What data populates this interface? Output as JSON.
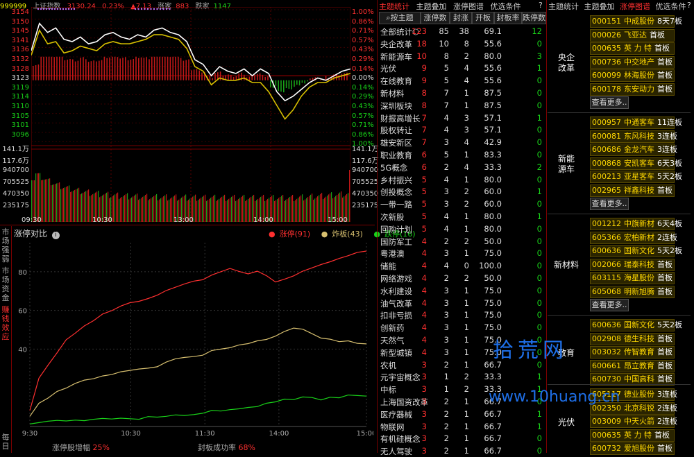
{
  "index_header": {
    "code": "999999",
    "name": "上证指数",
    "price": "3130.24",
    "pct": "0.23%",
    "change": "▲7.13",
    "up_label": "涨家",
    "up_count": "883",
    "down_label": "跌家",
    "down_count": "1147"
  },
  "left_axis": [
    "3154",
    "3150",
    "3145",
    "3141",
    "3136",
    "3132",
    "3128",
    "3123",
    "3119",
    "3114",
    "3110",
    "3105",
    "3101",
    "3096",
    "141.1万",
    "117.6万",
    "940700",
    "705525",
    "470350",
    "235175"
  ],
  "right_axis": [
    "1.00%",
    "0.86%",
    "0.71%",
    "0.57%",
    "0.43%",
    "0.29%",
    "0.14%",
    "0.00%",
    "0.14%",
    "0.29%",
    "0.43%",
    "0.57%",
    "0.71%",
    "0.86%",
    "1.00%",
    "141.1万",
    "117.6万",
    "940700",
    "705525",
    "470350",
    "235175"
  ],
  "time_axis": [
    "09:30",
    "10:30",
    "13:00",
    "14:00",
    "15:00"
  ],
  "zt_panel": {
    "title": "涨停对比",
    "legend": [
      {
        "label": "涨停(91)",
        "color": "#ff3030"
      },
      {
        "label": "炸板(43)",
        "color": "#d8c070"
      },
      {
        "label": "跌停(16)",
        "color": "#19d219"
      }
    ],
    "side_tabs": [
      "市场强弱",
      "市场资金",
      "赚钱效应",
      "每日"
    ],
    "footer_zf_label": "涨停股增幅",
    "footer_zf_value": "25%",
    "footer_fb_label": "封板成功率",
    "footer_fb_value": "68%"
  },
  "chart_data": [
    {
      "type": "line",
      "title": "",
      "xlabel": "",
      "ylabel": "",
      "x_ticks": [
        "09:30",
        "10:30",
        "13:00",
        "14:00",
        "15:00"
      ],
      "ylim": [
        3096,
        3154
      ],
      "series": [
        {
          "name": "",
          "color": "#ffffff",
          "values": [
            3136,
            3148,
            3144,
            3146,
            3141,
            3140,
            3142,
            3139,
            3140,
            3143,
            3144,
            3142,
            3141,
            3143,
            3142,
            3145,
            3146,
            3144,
            3143,
            3140,
            3132,
            3130,
            3125,
            3129,
            3127,
            3126,
            3128,
            3125,
            3128,
            3126,
            3118,
            3114,
            3116,
            3119,
            3122,
            3124,
            3123,
            3125,
            3127,
            3128
          ]
        },
        {
          "name": "",
          "color": "#d8c000",
          "values": [
            3134,
            3145,
            3139,
            3140,
            3135,
            3136,
            3138,
            3137,
            3136,
            3139,
            3140,
            3139,
            3139,
            3140,
            3141,
            3143,
            3143,
            3142,
            3141,
            3137,
            3129,
            3127,
            3121,
            3124,
            3123,
            3123,
            3124,
            3122,
            3122,
            3118,
            3112,
            3106,
            3110,
            3116,
            3120,
            3122,
            3122,
            3124,
            3125,
            3126
          ]
        }
      ]
    },
    {
      "type": "line",
      "title": "",
      "xlabel": "",
      "ylabel": "",
      "x_ticks": [
        "9:30",
        "10:30",
        "11:30",
        "14:00",
        "15:00"
      ],
      "yticks": [
        40,
        60,
        80
      ],
      "ylim": [
        0,
        95
      ],
      "series": [
        {
          "name": "涨停",
          "color": "#ff3030",
          "values": [
            8,
            25,
            32,
            38,
            45,
            48,
            52,
            55,
            58,
            60,
            62,
            64,
            65,
            66,
            68,
            70,
            72,
            74,
            75,
            76,
            78,
            80,
            82,
            80,
            79,
            80,
            78,
            75,
            76,
            78,
            80,
            82,
            84,
            85,
            87,
            88,
            90,
            91
          ]
        },
        {
          "name": "炸板",
          "color": "#d8c070",
          "values": [
            5,
            12,
            15,
            18,
            20,
            22,
            24,
            25,
            26,
            27,
            28,
            29,
            30,
            30,
            31,
            33,
            35,
            36,
            36,
            37,
            39,
            40,
            41,
            42,
            43,
            44,
            45,
            47,
            49,
            51,
            50,
            48,
            46,
            45,
            44,
            44,
            43,
            43
          ]
        },
        {
          "name": "跌停",
          "color": "#19d219",
          "values": [
            1,
            2,
            3,
            3,
            3,
            3,
            3,
            4,
            4,
            4,
            4,
            4,
            4,
            5,
            5,
            5,
            6,
            6,
            6,
            7,
            8,
            8,
            9,
            9,
            10,
            10,
            12,
            13,
            14,
            14,
            15,
            15,
            14,
            15,
            15,
            16,
            16,
            16
          ]
        }
      ]
    }
  ],
  "mid": {
    "tabs": [
      "主题统计",
      "主题叠加",
      "涨停图谱",
      "优选条件"
    ],
    "help": "?",
    "headers": [
      "按主题",
      "涨停数",
      "封涨",
      "开板",
      "封板率",
      "跌停数"
    ],
    "rows": [
      {
        "name": "全部统计",
        "icon": "○",
        "v": [
          "123",
          "85",
          "38",
          "69.1",
          "12"
        ]
      },
      {
        "name": "央企改革",
        "v": [
          "18",
          "10",
          "8",
          "55.6",
          "0"
        ]
      },
      {
        "name": "新能源车",
        "v": [
          "10",
          "8",
          "2",
          "80.0",
          "3"
        ]
      },
      {
        "name": "光伏",
        "v": [
          "9",
          "5",
          "4",
          "55.6",
          "1"
        ]
      },
      {
        "name": "在线教育",
        "v": [
          "9",
          "5",
          "4",
          "55.6",
          "0"
        ]
      },
      {
        "name": "新材料",
        "v": [
          "8",
          "7",
          "1",
          "87.5",
          "0"
        ]
      },
      {
        "name": "深圳板块",
        "v": [
          "8",
          "7",
          "1",
          "87.5",
          "0"
        ]
      },
      {
        "name": "财报高增长",
        "v": [
          "7",
          "4",
          "3",
          "57.1",
          "1"
        ]
      },
      {
        "name": "股权转让",
        "v": [
          "7",
          "4",
          "3",
          "57.1",
          "0"
        ]
      },
      {
        "name": "雄安新区",
        "v": [
          "7",
          "3",
          "4",
          "42.9",
          "0"
        ]
      },
      {
        "name": "职业教育",
        "v": [
          "6",
          "5",
          "1",
          "83.3",
          "0"
        ]
      },
      {
        "name": "5G概念",
        "v": [
          "6",
          "2",
          "4",
          "33.3",
          "2"
        ]
      },
      {
        "name": "乡村振兴",
        "v": [
          "5",
          "4",
          "1",
          "80.0",
          "0"
        ]
      },
      {
        "name": "创投概念",
        "v": [
          "5",
          "3",
          "2",
          "60.0",
          "1"
        ]
      },
      {
        "name": "一带一路",
        "v": [
          "5",
          "3",
          "2",
          "60.0",
          "0"
        ]
      },
      {
        "name": "次新股",
        "v": [
          "5",
          "4",
          "1",
          "80.0",
          "1"
        ]
      },
      {
        "name": "回购计划",
        "v": [
          "5",
          "4",
          "1",
          "80.0",
          "0"
        ]
      },
      {
        "name": "国防军工",
        "v": [
          "4",
          "2",
          "2",
          "50.0",
          "0"
        ]
      },
      {
        "name": "粤港澳",
        "v": [
          "4",
          "3",
          "1",
          "75.0",
          "0"
        ]
      },
      {
        "name": "储能",
        "v": [
          "4",
          "4",
          "0",
          "100.0",
          "0"
        ]
      },
      {
        "name": "网络游戏",
        "v": [
          "4",
          "2",
          "2",
          "50.0",
          "0"
        ]
      },
      {
        "name": "水利建设",
        "v": [
          "4",
          "3",
          "1",
          "75.0",
          "0"
        ]
      },
      {
        "name": "油气改革",
        "v": [
          "4",
          "3",
          "1",
          "75.0",
          "0"
        ]
      },
      {
        "name": "扣非亏损",
        "v": [
          "4",
          "3",
          "1",
          "75.0",
          "0"
        ]
      },
      {
        "name": "创新药",
        "v": [
          "4",
          "3",
          "1",
          "75.0",
          "0"
        ]
      },
      {
        "name": "天然气",
        "v": [
          "4",
          "3",
          "1",
          "75.0",
          "0"
        ]
      },
      {
        "name": "新型城镇",
        "v": [
          "4",
          "3",
          "1",
          "75.0",
          "0"
        ]
      },
      {
        "name": "农机",
        "v": [
          "3",
          "2",
          "1",
          "66.7",
          "0"
        ]
      },
      {
        "name": "元宇宙概念",
        "v": [
          "3",
          "1",
          "2",
          "33.3",
          "1"
        ]
      },
      {
        "name": "中标",
        "v": [
          "3",
          "1",
          "2",
          "33.3",
          "1"
        ]
      },
      {
        "name": "上海国资改革",
        "v": [
          "3",
          "2",
          "1",
          "66.7",
          "0"
        ]
      },
      {
        "name": "医疗器械",
        "v": [
          "3",
          "2",
          "1",
          "66.7",
          "1"
        ]
      },
      {
        "name": "物联网",
        "v": [
          "3",
          "2",
          "1",
          "66.7",
          "1"
        ]
      },
      {
        "name": "有机硅概念",
        "v": [
          "3",
          "2",
          "1",
          "66.7",
          "0"
        ]
      },
      {
        "name": "无人驾驶",
        "v": [
          "3",
          "2",
          "1",
          "66.7",
          "0"
        ]
      }
    ]
  },
  "right": {
    "tabs": [
      "主题统计",
      "主题叠加",
      "涨停图谱",
      "优选条件"
    ],
    "help": "?",
    "more_label": "查看更多..",
    "groups": [
      {
        "name": "央企\n改革",
        "stocks": [
          {
            "code": "000151",
            "name": "中成股份",
            "board": "8天7板"
          },
          {
            "code": "000026",
            "name": "飞亚达",
            "board": "首板"
          },
          {
            "code": "000635",
            "name": "英 力 特",
            "board": "首板"
          },
          {
            "code": "000736",
            "name": "中交地产",
            "board": "首板"
          },
          {
            "code": "600099",
            "name": "林海股份",
            "board": "首板"
          },
          {
            "code": "600178",
            "name": "东安动力",
            "board": "首板"
          }
        ],
        "more": true
      },
      {
        "name": "新能\n源车",
        "stocks": [
          {
            "code": "000957",
            "name": "中通客车",
            "board": "11连板"
          },
          {
            "code": "600081",
            "name": "东风科技",
            "board": "3连板"
          },
          {
            "code": "600686",
            "name": "金龙汽车",
            "board": "3连板"
          },
          {
            "code": "000868",
            "name": "安凯客车",
            "board": "6天3板"
          },
          {
            "code": "600213",
            "name": "亚星客车",
            "board": "5天2板"
          },
          {
            "code": "002965",
            "name": "祥鑫科技",
            "board": "首板"
          }
        ],
        "more": true
      },
      {
        "name": "新材料",
        "stocks": [
          {
            "code": "001212",
            "name": "中旗新材",
            "board": "6天4板"
          },
          {
            "code": "605366",
            "name": "宏柏新材",
            "board": "2连板"
          },
          {
            "code": "600636",
            "name": "国新文化",
            "board": "5天2板"
          },
          {
            "code": "002066",
            "name": "瑞泰科技",
            "board": "首板"
          },
          {
            "code": "603115",
            "name": "海星股份",
            "board": "首板"
          },
          {
            "code": "605068",
            "name": "明新旭腾",
            "board": "首板"
          }
        ],
        "more": true
      },
      {
        "name": "教育",
        "stocks": [
          {
            "code": "600636",
            "name": "国新文化",
            "board": "5天2板"
          },
          {
            "code": "002908",
            "name": "德生科技",
            "board": "首板"
          },
          {
            "code": "003032",
            "name": "传智教育",
            "board": "首板"
          },
          {
            "code": "600661",
            "name": "昂立教育",
            "board": "首板"
          },
          {
            "code": "600730",
            "name": "中国高科",
            "board": "首板"
          }
        ],
        "more": false
      },
      {
        "name": "光伏",
        "stocks": [
          {
            "code": "605117",
            "name": "德业股份",
            "board": "3连板"
          },
          {
            "code": "002350",
            "name": "北京科锐",
            "board": "2连板"
          },
          {
            "code": "003009",
            "name": "中天火箭",
            "board": "2连板"
          },
          {
            "code": "000635",
            "name": "英 力 特",
            "board": "首板"
          },
          {
            "code": "600732",
            "name": "爱旭股份",
            "board": "首板"
          }
        ],
        "more": false
      }
    ]
  },
  "watermark": {
    "cn": "拾荒网",
    "url": "www.10huang.cn"
  }
}
